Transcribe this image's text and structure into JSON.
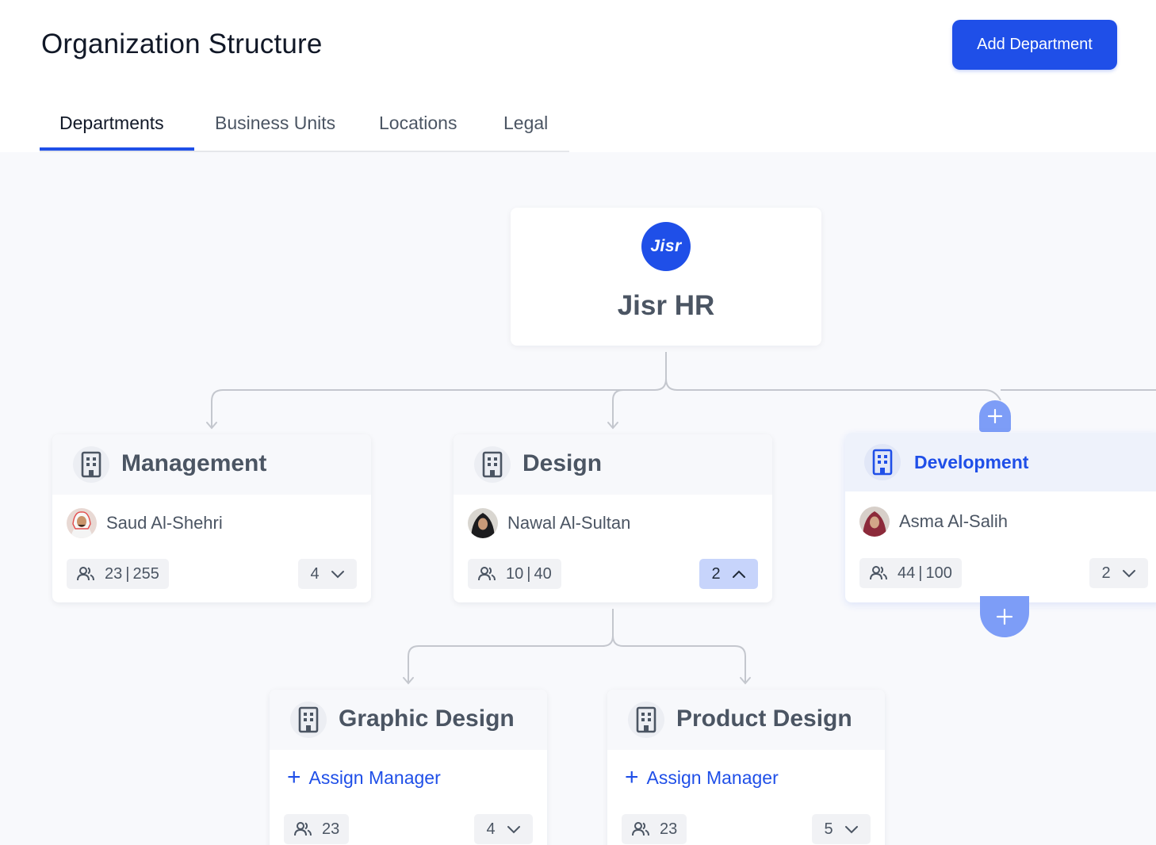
{
  "page": {
    "title": "Organization Structure",
    "add_button": "Add Department"
  },
  "tabs": [
    {
      "label": "Departments",
      "active": true
    },
    {
      "label": "Business Units",
      "active": false
    },
    {
      "label": "Locations",
      "active": false
    },
    {
      "label": "Legal",
      "active": false
    }
  ],
  "root": {
    "logo_text": "Jisr",
    "name": "Jisr HR"
  },
  "departments": [
    {
      "name": "Management",
      "manager": "Saud Al-Shehri",
      "employees": "23",
      "capacity": "255",
      "subdepartments": "4",
      "expanded": false
    },
    {
      "name": "Design",
      "manager": "Nawal Al-Sultan",
      "employees": "10",
      "capacity": "40",
      "subdepartments": "2",
      "expanded": true
    },
    {
      "name": "Development",
      "manager": "Asma Al-Salih",
      "employees": "44",
      "capacity": "100",
      "subdepartments": "2",
      "expanded": false,
      "selected": true
    }
  ],
  "subdepartments": [
    {
      "name": "Graphic Design",
      "assign_label": "Assign Manager",
      "employees": "23",
      "subdepartments": "4"
    },
    {
      "name": "Product Design",
      "assign_label": "Assign Manager",
      "employees": "23",
      "subdepartments": "5"
    }
  ],
  "icons": {
    "department": "building-icon",
    "employees": "users-icon",
    "chevron_down": "chevron-down-icon",
    "chevron_up": "chevron-up-icon",
    "add": "plus-icon"
  },
  "colors": {
    "primary": "#1f4fe8",
    "add_circle": "#7d9df7",
    "pill_open": "#c7d4fb",
    "canvas_bg": "#f8f9fc",
    "connector": "#c4c7ce"
  }
}
